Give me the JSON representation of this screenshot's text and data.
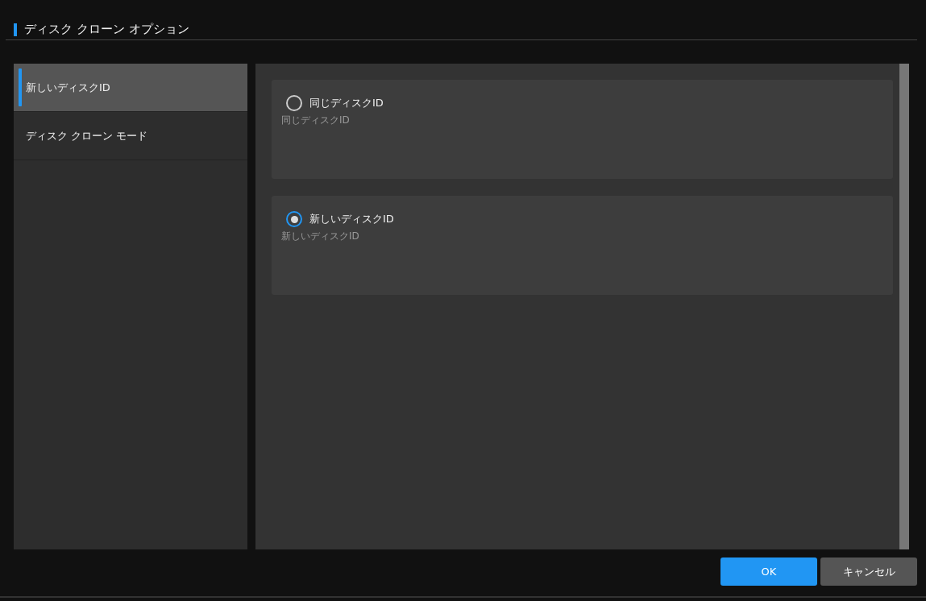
{
  "title": "ディスク クローン オプション",
  "sidebar": {
    "items": [
      {
        "label": "新しいディスクID",
        "selected": true
      },
      {
        "label": "ディスク クローン モード",
        "selected": false
      }
    ]
  },
  "options": [
    {
      "label": "同じディスクID",
      "description": "同じディスクID",
      "selected": false
    },
    {
      "label": "新しいディスクID",
      "description": "新しいディスクID",
      "selected": true
    }
  ],
  "buttons": [
    {
      "label": "OK",
      "kind": "primary"
    },
    {
      "label": "キャンセル",
      "kind": "secondary"
    }
  ]
}
